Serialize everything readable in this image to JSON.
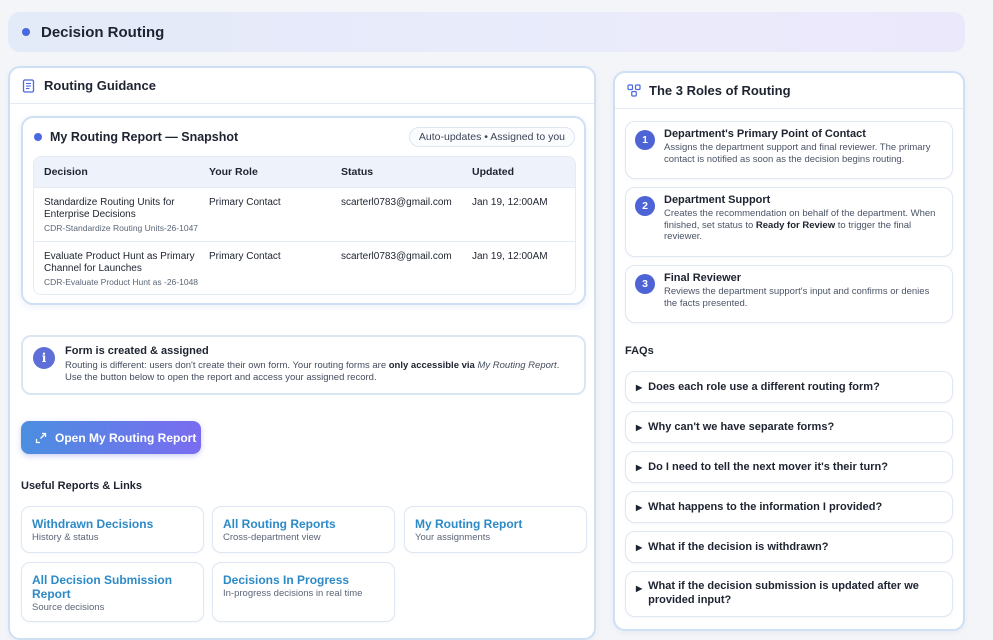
{
  "header": {
    "title": "Decision Routing"
  },
  "guidance": {
    "title": "Routing Guidance",
    "snapshot": {
      "title": "My Routing Report — Snapshot",
      "pill": "Auto-updates • Assigned to you",
      "columns": [
        "Decision",
        "Your Role",
        "Status",
        "Updated"
      ],
      "rows": [
        {
          "decision": "Standardize Routing Units for Enterprise Decisions",
          "sub": "CDR-Standardize Routing Units-26-1047",
          "role": "Primary Contact",
          "status": "scarterl0783@gmail.com",
          "updated": "Jan 19, 12:00AM"
        },
        {
          "decision": "Evaluate Product Hunt as Primary Channel for Launches",
          "sub": "CDR-Evaluate Product Hunt as -26-1048",
          "role": "Primary Contact",
          "status": "scarterl0783@gmail.com",
          "updated": "Jan 19, 12:00AM"
        }
      ]
    },
    "info": {
      "title": "Form is created & assigned",
      "body_pre": "Routing is different: users don't create their own form. Your routing forms are ",
      "body_strong": "only accessible via",
      "body_em": "My Routing Report",
      "body_post": ". Use the button below to open the report and access your assigned record."
    },
    "cta": "Open My Routing Report",
    "links_title": "Useful Reports & Links",
    "links": [
      {
        "title": "Withdrawn Decisions",
        "sub": "History & status"
      },
      {
        "title": "All Routing Reports",
        "sub": "Cross-department view"
      },
      {
        "title": "My Routing Report",
        "sub": "Your assignments"
      },
      {
        "title": "All Decision Submission Report",
        "sub": "Source decisions"
      },
      {
        "title": "Decisions In Progress",
        "sub": "In-progress decisions in real time"
      }
    ]
  },
  "roles": {
    "title": "The 3 Roles of Routing",
    "items": [
      {
        "num": "1",
        "title": "Department's Primary Point of Contact",
        "body": "Assigns the department support and final reviewer. The primary contact is notified as soon as the decision begins routing."
      },
      {
        "num": "2",
        "title": "Department Support",
        "body_pre": "Creates the recommendation on behalf of the department. When finished, set status to ",
        "body_strong": "Ready for Review",
        "body_post": " to trigger the final reviewer."
      },
      {
        "num": "3",
        "title": "Final Reviewer",
        "body": "Reviews the department support's input and confirms or denies the facts presented."
      }
    ],
    "faqs_title": "FAQs",
    "faqs": [
      "Does each role use a different routing form?",
      "Why can't we have separate forms?",
      "Do I need to tell the next mover it's their turn?",
      "What happens to the information I provided?",
      "What if the decision is withdrawn?",
      "What if the decision submission is updated after we provided input?"
    ]
  },
  "colors": {
    "accent": "#4a68e0",
    "link": "#2d8ac7",
    "border": "#cfe0f5"
  }
}
